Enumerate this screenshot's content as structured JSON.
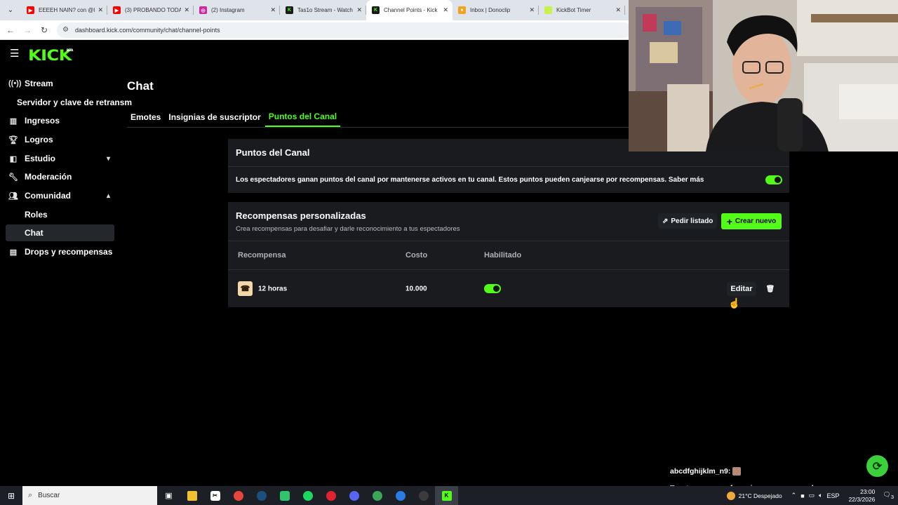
{
  "browser": {
    "tabs": [
      {
        "title": "EEEEH NAIN? con @l",
        "favicon": "youtube-icon",
        "color": "#ff0000"
      },
      {
        "title": "(3) PROBANDO TODA",
        "favicon": "youtube-icon",
        "color": "#ff0000"
      },
      {
        "title": "(2) Instagram",
        "favicon": "instagram-icon",
        "color": "#d6249f"
      },
      {
        "title": "Tas1o Stream - Watch",
        "favicon": "kick-icon",
        "color": "#1a1a1a"
      },
      {
        "title": "Channel Points - Kick",
        "favicon": "kick-icon",
        "color": "#1a1a1a",
        "active": true
      },
      {
        "title": "Inbox | Donoclip",
        "favicon": "donoclip-icon",
        "color": "#f3a21b"
      },
      {
        "title": "KickBot Timer",
        "favicon": "kickbot-icon",
        "color": "#c8f24a"
      }
    ],
    "url": "dashboard.kick.com/community/chat/channel-points"
  },
  "brand": {
    "logo": "KICK",
    "badge": "BETA",
    "accent": "#53fc18"
  },
  "sidebar": {
    "items": [
      {
        "label": "Stream",
        "icon": "broadcast-icon"
      },
      {
        "label": "Servidor y clave de retransmisión",
        "icon": ""
      },
      {
        "label": "Ingresos",
        "icon": "chart-icon"
      },
      {
        "label": "Logros",
        "icon": "trophy-icon"
      },
      {
        "label": "Estudio",
        "icon": "studio-icon",
        "chevron": "down"
      },
      {
        "label": "Moderación",
        "icon": "wrench-icon"
      },
      {
        "label": "Comunidad",
        "icon": "community-icon",
        "chevron": "up"
      },
      {
        "label": "Roles",
        "icon": ""
      },
      {
        "label": "Chat",
        "icon": "",
        "active": true
      },
      {
        "label": "Drops y recompensas",
        "icon": "drops-icon"
      }
    ]
  },
  "page": {
    "title": "Chat",
    "tabs": [
      "Emotes",
      "Insignias de suscriptor",
      "Puntos del Canal"
    ],
    "active_tab": "Puntos del Canal"
  },
  "channel_points": {
    "title": "Puntos del Canal",
    "description": "Los espectadores ganan puntos del canal por mantenerse activos en tu canal. Estos puntos pueden canjearse por recompensas. Saber más",
    "enabled": true
  },
  "rewards": {
    "title": "Recompensas personalizadas",
    "subtitle": "Crea recompensas para desafiar y darle reconocimiento a tus espectadores",
    "request_button": "Pedir listado",
    "create_button": "Crear nuevo",
    "columns": [
      "Recompensa",
      "Costo",
      "Habilitado"
    ],
    "rows": [
      {
        "name": "12 horas",
        "cost": "10.000",
        "enabled": true,
        "edit_label": "Editar"
      }
    ]
  },
  "chat_overlay": {
    "line1_user": "abcdfghijklm_n9:",
    "line2_user": "Tacatun:",
    "line2_text": "yo me ofreceria pero no se moderar"
  },
  "taskbar": {
    "search_placeholder": "Buscar",
    "weather": "21°C  Despejado",
    "lang": "ESP",
    "time": "23:00",
    "date": "22/3/2026",
    "notif_count": "3"
  }
}
